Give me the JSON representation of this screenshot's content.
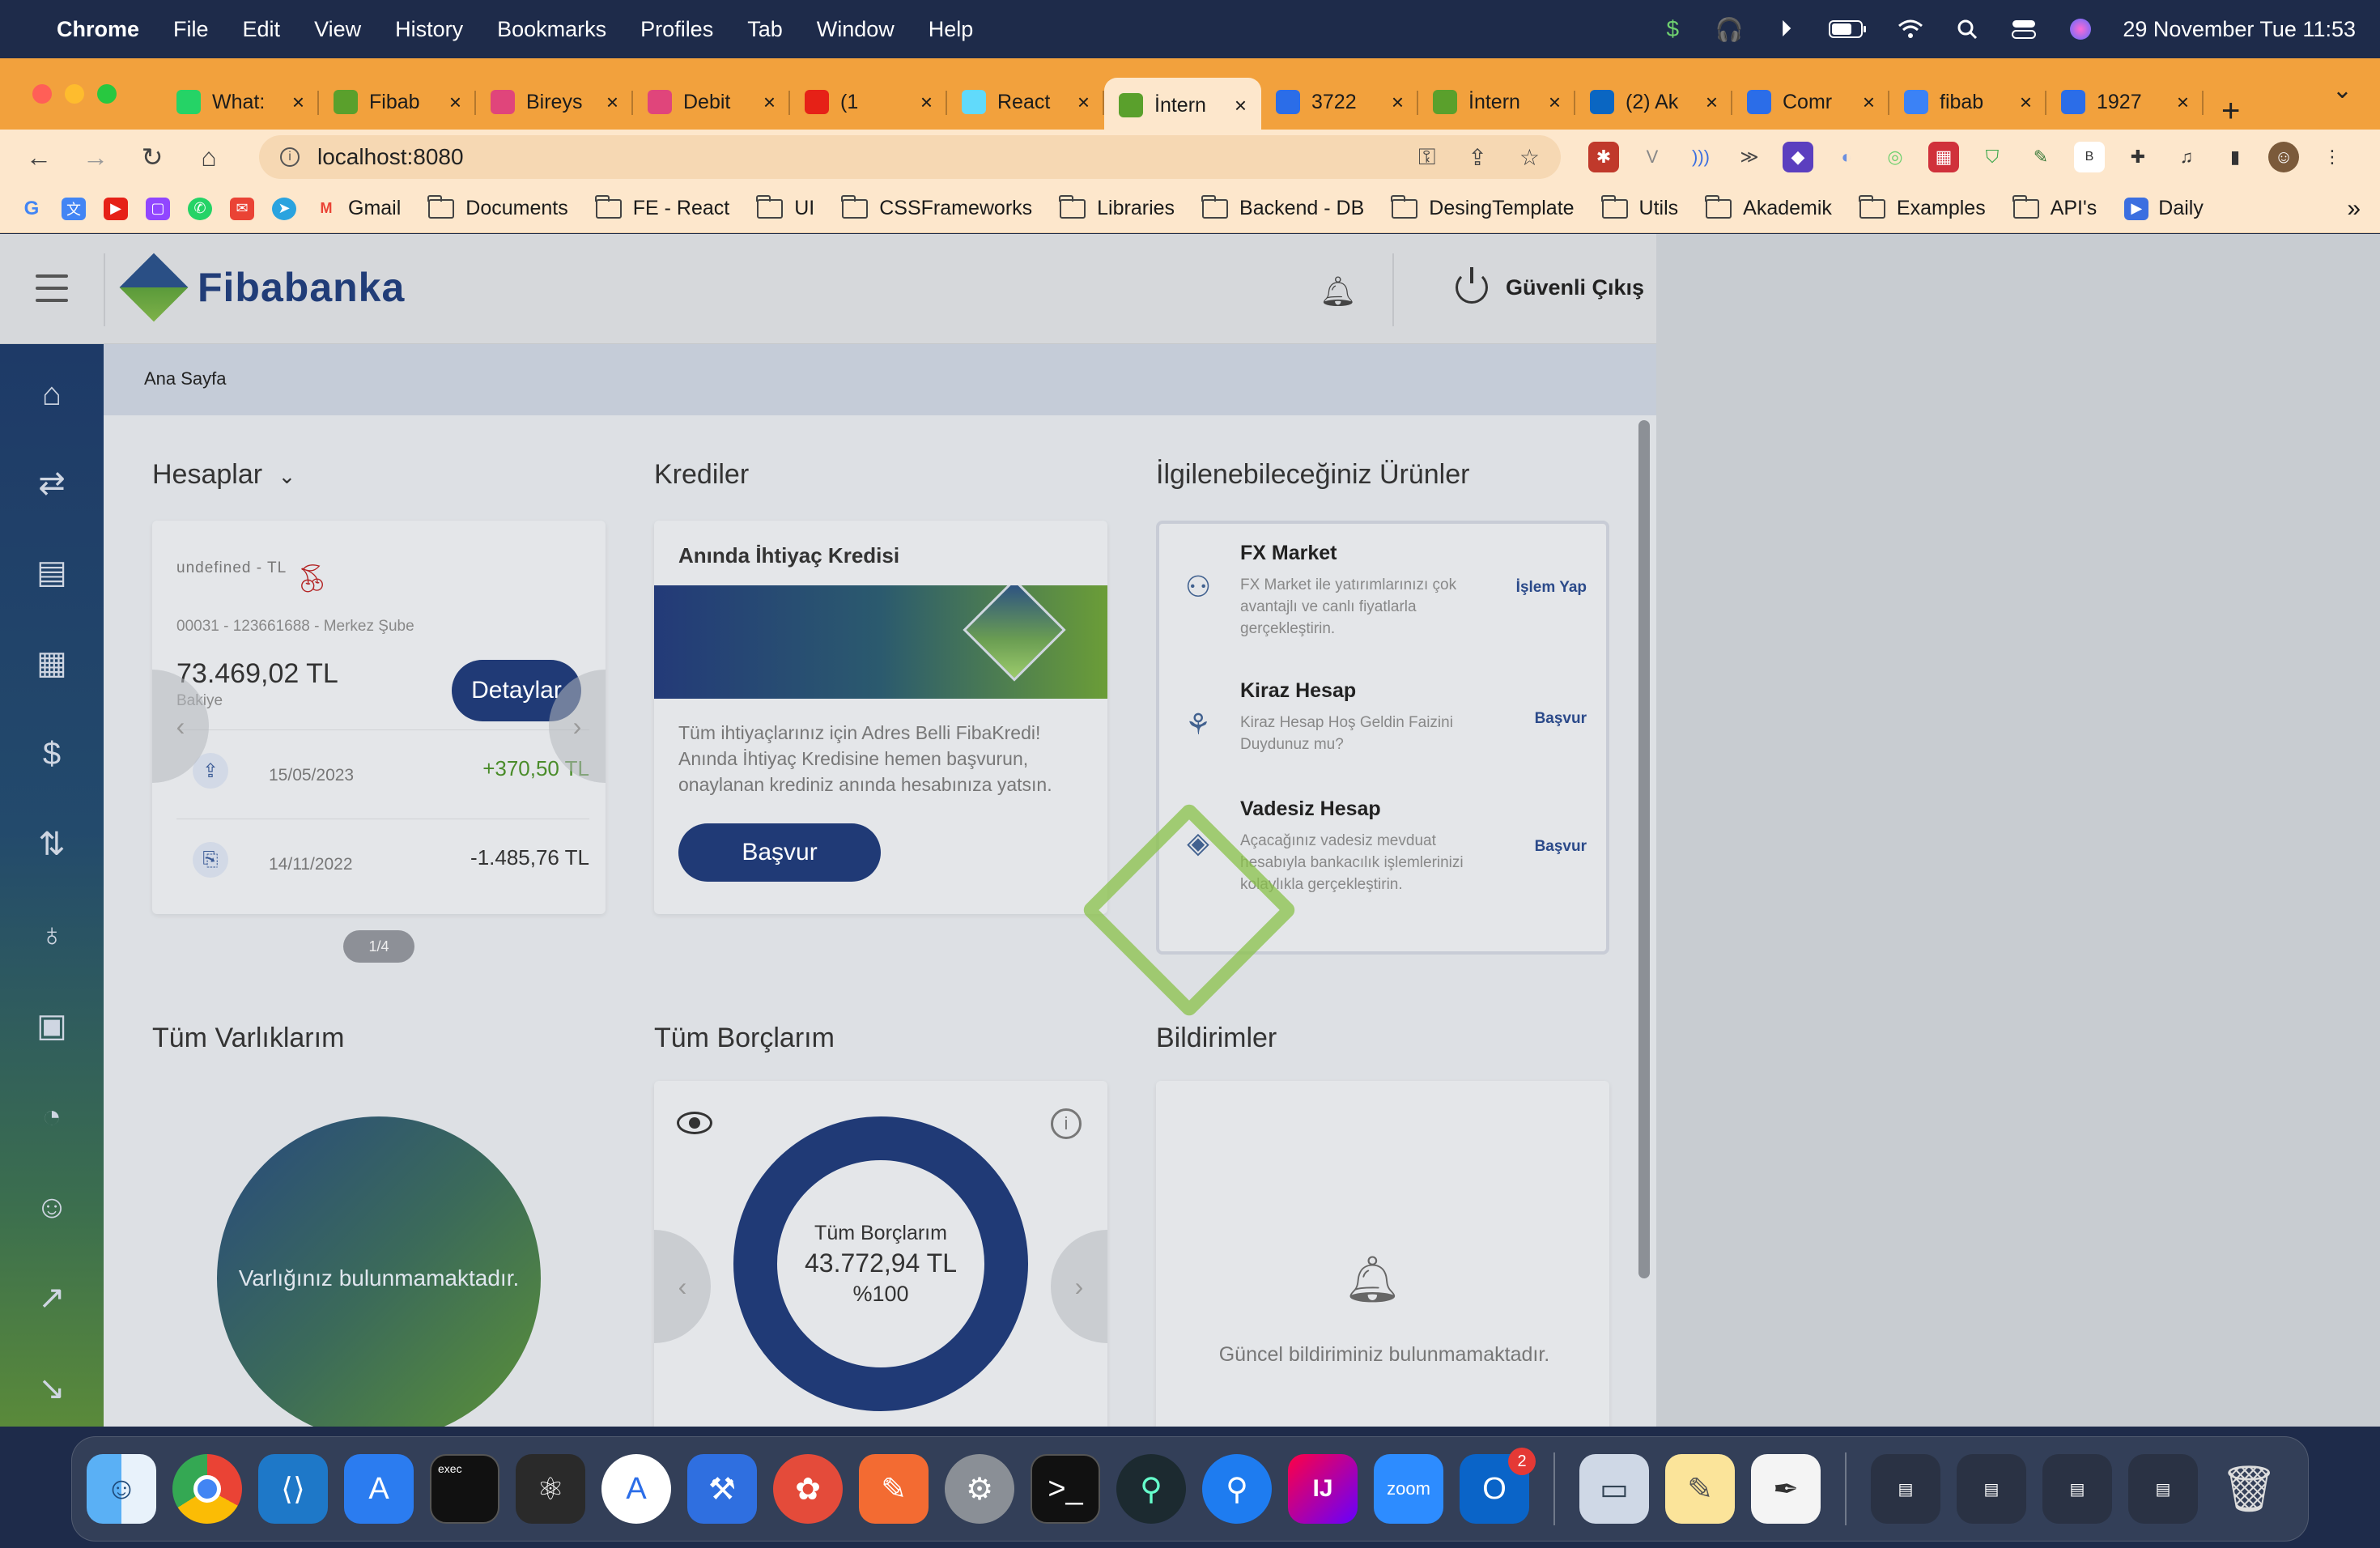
{
  "menubar": {
    "app": "Chrome",
    "items": [
      "File",
      "Edit",
      "View",
      "History",
      "Bookmarks",
      "Profiles",
      "Tab",
      "Window",
      "Help"
    ],
    "datetime": "29 November Tue  11:53"
  },
  "tabs": [
    {
      "label": "What:",
      "color": "#25d366",
      "icon": "whatsapp-icon"
    },
    {
      "label": "Fibab",
      "color": "#5aa02c",
      "icon": "fibabanka-icon"
    },
    {
      "label": "Bireys",
      "color": "#e0457b",
      "icon": "figma-icon"
    },
    {
      "label": "Debit",
      "color": "#e0457b",
      "icon": "figma-icon"
    },
    {
      "label": "(1",
      "color": "#e62117",
      "icon": "youtube-icon"
    },
    {
      "label": "React",
      "color": "#61dafb",
      "icon": "react-icon"
    },
    {
      "label": "İntern",
      "color": "#5aa02c",
      "icon": "fibabanka-icon",
      "active": true
    },
    {
      "label": "3722",
      "color": "#2b6de8",
      "icon": "jira-icon"
    },
    {
      "label": "İntern",
      "color": "#5aa02c",
      "icon": "fibabanka-icon"
    },
    {
      "label": "(2) Ak",
      "color": "#0a66c2",
      "icon": "linkedin-icon"
    },
    {
      "label": "Comr",
      "color": "#2b6de8",
      "icon": "jira-icon"
    },
    {
      "label": "fibab",
      "color": "#3b82f6",
      "icon": "box-icon"
    },
    {
      "label": "1927",
      "color": "#2b6de8",
      "icon": "jira-icon"
    }
  ],
  "address": {
    "url": "localhost:8080"
  },
  "bookmarks": {
    "items": [
      "Gmail",
      "Documents",
      "FE - React",
      "UI",
      "CSSFrameworks",
      "Libraries",
      "Backend - DB",
      "DesingTemplate",
      "Utils",
      "Akademik",
      "Examples",
      "API's",
      "Daily"
    ],
    "more": "»"
  },
  "app": {
    "brand": "Fibabanka",
    "logout": "Güvenli Çıkış",
    "breadcrumb": "Ana Sayfa",
    "accounts": {
      "title": "Hesaplar",
      "name": "undefined - TL",
      "number": "00031 - 123661688 - Merkez Şube",
      "balance": "73.469,02 TL",
      "balance_label": "Bakiye",
      "details_button": "Detaylar",
      "transactions": [
        {
          "date": "15/05/2023",
          "amount": "+370,50 TL",
          "color": "#4a8c2a"
        },
        {
          "date": "14/11/2022",
          "amount": "-1.485,76 TL",
          "color": "#333333"
        }
      ],
      "pager": "1/4"
    },
    "credits": {
      "title": "Krediler",
      "card_title": "Anında İhtiyaç Kredisi",
      "description": "Tüm ihtiyaçlarınız için Adres Belli FibaKredi! Anında İhtiyaç Kredisine hemen başvurun, onaylanan krediniz anında hesabınıza yatsın.",
      "apply_button": "Başvur"
    },
    "products": {
      "title": "İlgilenebileceğiniz Ürünler",
      "items": [
        {
          "title": "FX Market",
          "desc": "FX Market ile yatırımlarınızı çok avantajlı ve canlı fiyatlarla gerçekleştirin.",
          "action": "İşlem Yap",
          "icon": "fx-icon"
        },
        {
          "title": "Kiraz Hesap",
          "desc": "Kiraz Hesap Hoş Geldin Faizini Duydunuz mu?",
          "action": "Başvur",
          "icon": "cherry-account-icon"
        },
        {
          "title": "Vadesiz Hesap",
          "desc": "Açacağınız vadesiz mevduat hesabıyla bankacılık işlemlerinizi kolaylıkla gerçekleştirin.",
          "action": "Başvur",
          "icon": "demand-account-icon"
        }
      ]
    },
    "assets": {
      "title": "Tüm Varlıklarım",
      "empty": "Varlığınız bulunmamaktadır."
    },
    "debts": {
      "title": "Tüm Borçlarım",
      "label": "Tüm Borçlarım",
      "amount": "43.772,94 TL",
      "percent": "%100"
    },
    "notifications": {
      "title": "Bildirimler",
      "empty": "Güncel bildiriminiz bulunmamaktadır."
    }
  },
  "dock": {
    "outlook_badge": "2"
  }
}
